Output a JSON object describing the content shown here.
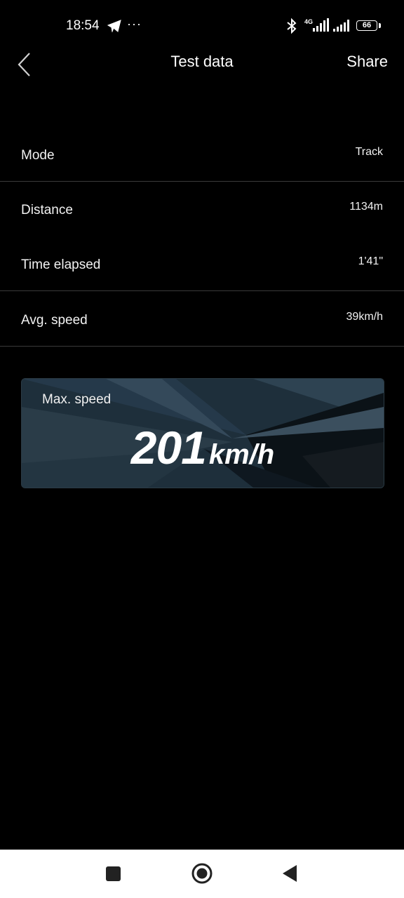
{
  "status": {
    "time": "18:54",
    "more": "···",
    "network": "4G",
    "battery": "66"
  },
  "header": {
    "title": "Test data",
    "share_label": "Share"
  },
  "rows": [
    {
      "label": "Mode",
      "value": "Track"
    },
    {
      "label": "Distance",
      "value": "1134m"
    },
    {
      "label": "Time elapsed",
      "value": "1'41\""
    },
    {
      "label": "Avg. speed",
      "value": "39km/h"
    }
  ],
  "max_speed": {
    "label": "Max. speed",
    "value": "201",
    "unit": "km/h"
  },
  "colors": {
    "background": "#000000",
    "card": "#1d2d38",
    "nav_bar": "#ffffff"
  }
}
